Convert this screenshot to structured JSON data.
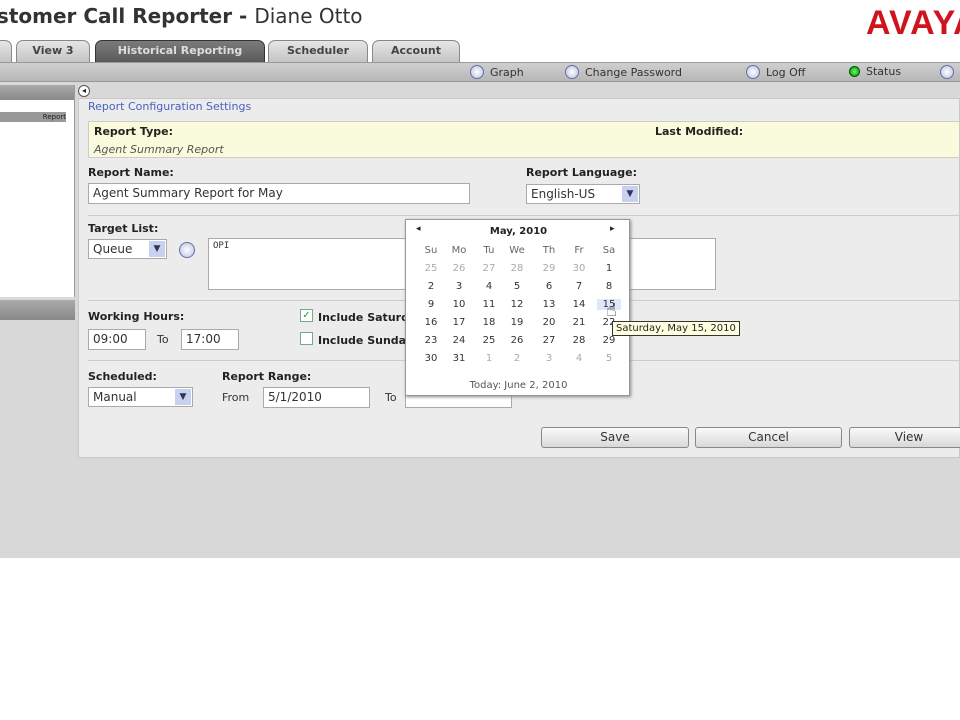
{
  "header": {
    "app_title": "Customer Call Reporter",
    "separator": " - ",
    "user": "Diane Otto",
    "logo": "AVAYA"
  },
  "tabs": [
    {
      "label": ""
    },
    {
      "label": "View 3"
    },
    {
      "label": "Historical Reporting"
    },
    {
      "label": "Scheduler"
    },
    {
      "label": "Account"
    }
  ],
  "toolbar": {
    "graph": "Graph",
    "change_password": "Change Password",
    "log_off": "Log Off",
    "status": "Status",
    "status_color": "#1a9a1a"
  },
  "sidebar": {
    "item": "Report"
  },
  "form": {
    "section_title": "Report Configuration Settings",
    "report_type_label": "Report Type:",
    "report_type_value": "Agent Summary Report",
    "last_modified_label": "Last Modified:",
    "report_name_label": "Report Name:",
    "report_name_value": "Agent Summary Report for May",
    "report_language_label": "Report Language:",
    "report_language_value": "English-US",
    "target_list_label": "Target List:",
    "target_type_value": "Queue",
    "target_list_value": "OPI",
    "working_hours_label": "Working Hours:",
    "hours_from": "09:00",
    "to_label": "To",
    "hours_to": "17:00",
    "include_saturday": "Include Saturday",
    "include_saturday_checked": true,
    "include_sunday": "Include Sunday",
    "include_sunday_checked": false,
    "scheduled_label": "Scheduled:",
    "scheduled_value": "Manual",
    "report_range_label": "Report Range:",
    "from_label": "From",
    "range_from": "5/1/2010",
    "range_to_label": "To",
    "range_to": ""
  },
  "buttons": {
    "save": "Save",
    "cancel": "Cancel",
    "view": "View"
  },
  "calendar": {
    "month": "May, 2010",
    "prev": "◂",
    "next": "▸",
    "days": [
      "Su",
      "Mo",
      "Tu",
      "We",
      "Th",
      "Fr",
      "Sa"
    ],
    "weeks": [
      [
        "25",
        "26",
        "27",
        "28",
        "29",
        "30",
        "1"
      ],
      [
        "2",
        "3",
        "4",
        "5",
        "6",
        "7",
        "8"
      ],
      [
        "9",
        "10",
        "11",
        "12",
        "13",
        "14",
        "15"
      ],
      [
        "16",
        "17",
        "18",
        "19",
        "20",
        "21",
        "22"
      ],
      [
        "23",
        "24",
        "25",
        "26",
        "27",
        "28",
        "29"
      ],
      [
        "30",
        "31",
        "1",
        "2",
        "3",
        "4",
        "5"
      ]
    ],
    "today": "Today: June 2, 2010",
    "hovered": "15",
    "tooltip": "Saturday, May 15, 2010"
  }
}
